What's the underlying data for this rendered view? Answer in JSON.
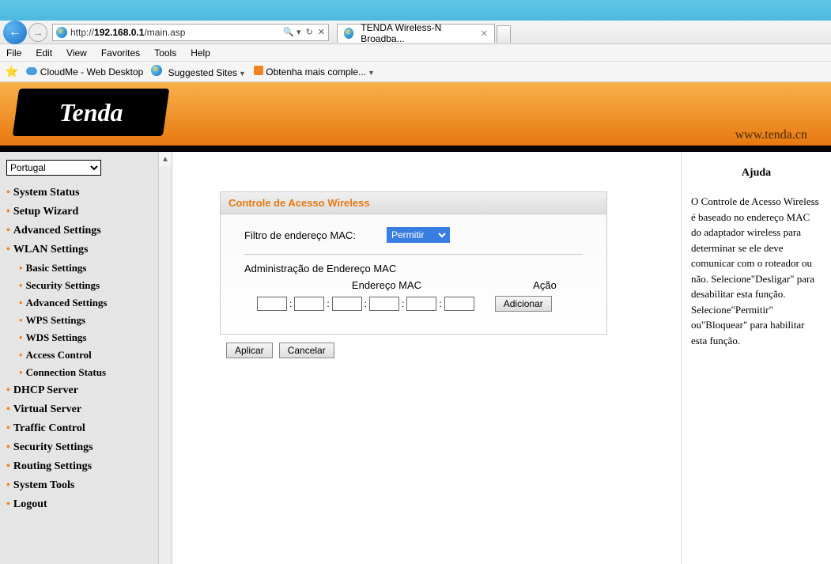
{
  "browser": {
    "url_prefix": "http://",
    "url_host": "192.168.0.1",
    "url_path": "/main.asp",
    "tab_title": "TENDA Wireless-N Broadba...",
    "menu": {
      "file": "File",
      "edit": "Edit",
      "view": "View",
      "favorites": "Favorites",
      "tools": "Tools",
      "help": "Help"
    },
    "fav": {
      "cloudme": "CloudMe - Web Desktop",
      "suggested": "Suggested Sites",
      "obtenha": "Obtenha mais comple..."
    }
  },
  "header": {
    "logo": "Tenda",
    "url": "www.tenda.cn"
  },
  "sidebar": {
    "language": "Portugal",
    "items": [
      "System Status",
      "Setup Wizard",
      "Advanced Settings",
      "WLAN Settings"
    ],
    "wlan_sub": [
      "Basic Settings",
      "Security Settings",
      "Advanced Settings",
      "WPS Settings",
      "WDS Settings",
      "Access Control",
      "Connection Status"
    ],
    "items2": [
      "DHCP Server",
      "Virtual Server",
      "Traffic Control",
      "Security Settings",
      "Routing Settings",
      "System Tools",
      "Logout"
    ]
  },
  "main": {
    "panel_title": "Controle de Acesso Wireless",
    "mac_filter_label": "Filtro de endereço MAC:",
    "mac_filter_value": "Permitir",
    "mac_admin_title": "Administração de Endereço MAC",
    "col_mac": "Endereço MAC",
    "col_action": "Ação",
    "add_btn": "Adicionar",
    "apply_btn": "Aplicar",
    "cancel_btn": "Cancelar"
  },
  "help": {
    "title": "Ajuda",
    "body": "O Controle de Acesso Wireless é baseado no endereço MAC do adaptador wireless para determinar se ele deve comunicar com o roteador ou não. Selecione\"Desligar\" para desabilitar esta função. Selecione\"Permitir\" ou\"Bloquear\" para habilitar esta função."
  }
}
